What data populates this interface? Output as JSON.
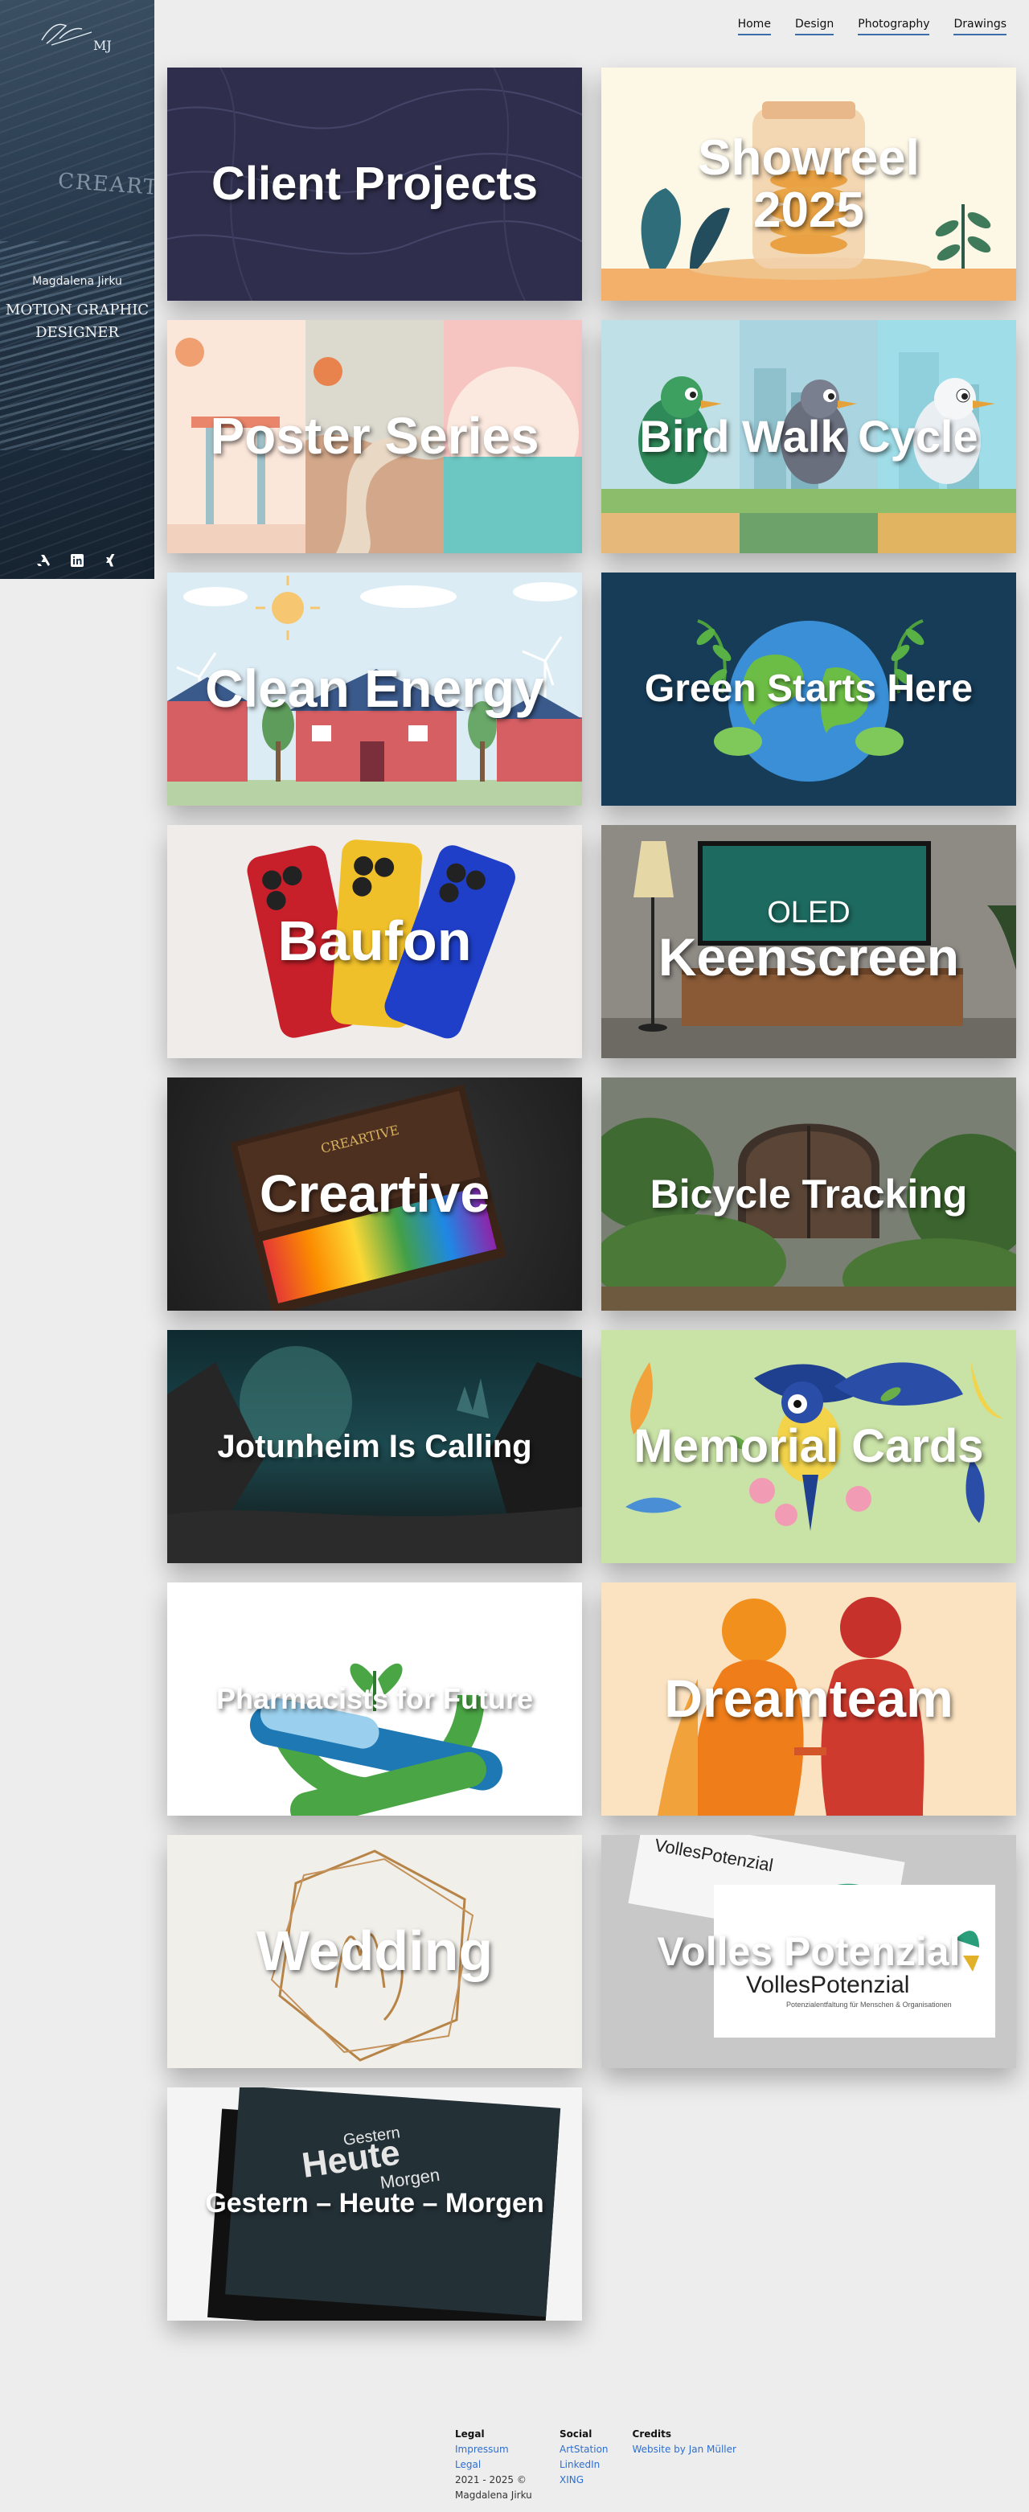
{
  "sidebar": {
    "logo_text": "MJ",
    "bg_word": "CREARTI",
    "name": "Magdalena Jirku",
    "role": "MOTION GRAPHIC DESIGNER",
    "social_icons": [
      "artstation-icon",
      "linkedin-icon",
      "xing-icon"
    ]
  },
  "nav": {
    "items": [
      "Home",
      "Design",
      "Photography",
      "Drawings"
    ]
  },
  "tiles": [
    {
      "title": "Client Projects",
      "size": 52
    },
    {
      "title": "Showreel 2025",
      "size": 60
    },
    {
      "title": "Poster Series",
      "size": 62
    },
    {
      "title": "Bird Walk Cycle",
      "size": 56
    },
    {
      "title": "Clean Energy",
      "size": 66
    },
    {
      "title": "Green Starts Here",
      "size": 48
    },
    {
      "title": "Baufon",
      "size": 70
    },
    {
      "title": "Keenscreen",
      "size": 66,
      "subtitle": "OLED"
    },
    {
      "title": "Creartive",
      "size": 66
    },
    {
      "title": "Bicycle Tracking",
      "size": 50
    },
    {
      "title": "Jotunheim Is Calling",
      "size": 40
    },
    {
      "title": "Memorial Cards",
      "size": 58
    },
    {
      "title": "Pharmacists for Future",
      "size": 36
    },
    {
      "title": "Dreamteam",
      "size": 66
    },
    {
      "title": "Wedding",
      "size": 70
    },
    {
      "title": "Volles Potenzial",
      "size": 50
    },
    {
      "title": "Gestern – Heute – Morgen",
      "size": 34
    }
  ],
  "tile_art": {
    "book_text": [
      "Gestern",
      "Heute",
      "Morgen"
    ],
    "card_brand": "VollesPotenzial",
    "card_tagline": "Potenzialentfaltung für Menschen & Organisationen",
    "box_label": "CREARTIVE"
  },
  "footer": {
    "legal_heading": "Legal",
    "legal_links": [
      "Impressum",
      "Legal"
    ],
    "copyright": "2021 - 2025 © Magdalena Jirku",
    "social_heading": "Social",
    "social_links": [
      "ArtStation",
      "LinkedIn",
      "XING"
    ],
    "credits_heading": "Credits",
    "credits_link": "Website by Jan Müller"
  },
  "colors": {
    "nav_underline": "#3b6ea8",
    "footer_link": "#2d6fd1"
  }
}
